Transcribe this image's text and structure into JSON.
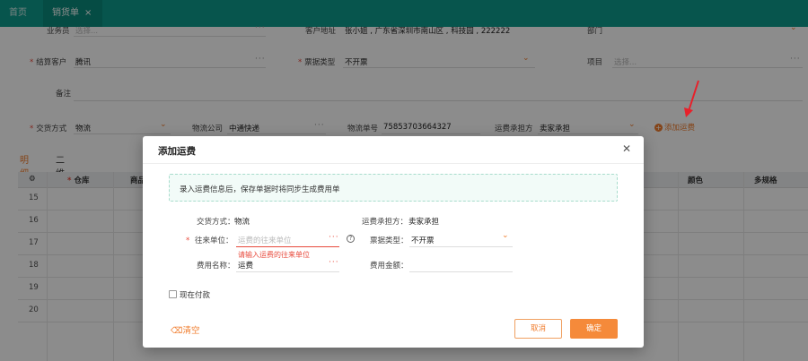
{
  "topbar": {
    "tabs": [
      {
        "label": "首页"
      },
      {
        "label": "销货单"
      }
    ],
    "close_glyph": "×"
  },
  "form": {
    "salesperson": {
      "label": "业务员",
      "placeholder": "选择..."
    },
    "customer_address": {
      "label": "客户地址",
      "value": "张小姐 , 广东省深圳市南山区 , 科技园 , 222222"
    },
    "department": {
      "label": "部门"
    },
    "settlement_customer": {
      "label": "结算客户",
      "value": "腾讯"
    },
    "invoice_type": {
      "label": "票据类型",
      "value": "不开票"
    },
    "project": {
      "label": "项目",
      "placeholder": "选择..."
    },
    "remark": {
      "label": "备注"
    },
    "delivery_method": {
      "label": "交货方式",
      "value": "物流"
    },
    "logistics_company": {
      "label": "物流公司",
      "value": "中通快递"
    },
    "tracking_number": {
      "label": "物流单号",
      "value": "75853703664327"
    },
    "freight_payer": {
      "label": "运费承担方",
      "value": "卖家承担"
    },
    "add_freight": "添加运费"
  },
  "detail_tabs": [
    {
      "label": "明细"
    },
    {
      "label": "二维"
    }
  ],
  "grid": {
    "columns": [
      "仓库",
      "商品",
      "颜色",
      "多规格"
    ],
    "rows": [
      "15",
      "16",
      "17",
      "18",
      "19",
      "20"
    ]
  },
  "modal": {
    "title": "添加运费",
    "notice": "录入运费信息后，保存单据时将同步生成费用单",
    "delivery_method": {
      "label": "交货方式：",
      "value": "物流"
    },
    "freight_payer": {
      "label": "运费承担方：",
      "value": "卖家承担"
    },
    "counterparty": {
      "label": "往来单位：",
      "placeholder": "运费的往来单位",
      "error": "请输入运费的往来单位"
    },
    "invoice_type": {
      "label": "票据类型：",
      "value": "不开票"
    },
    "fee_name": {
      "label": "费用名称：",
      "value": "运费"
    },
    "fee_amount": {
      "label": "费用金额："
    },
    "pay_now": "现在付款",
    "clear": "清空",
    "cancel": "取消",
    "confirm": "确定"
  },
  "colors": {
    "brand": "#0e9c8c",
    "accent": "#f07c2c",
    "error": "#e84a3c"
  }
}
